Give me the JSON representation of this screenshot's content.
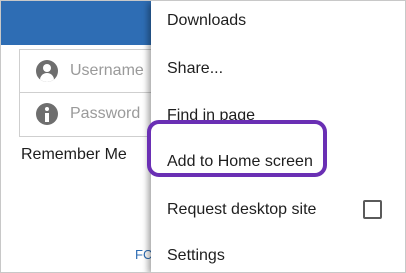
{
  "login": {
    "username_placeholder": "Username",
    "password_placeholder": "Password",
    "remember_label": "Remember Me",
    "bottom_link_partial": "FC"
  },
  "menu": {
    "items": [
      {
        "label": "Downloads"
      },
      {
        "label": "Share..."
      },
      {
        "label": "Find in page"
      },
      {
        "label": "Add to Home screen"
      },
      {
        "label": "Request desktop site",
        "checked": false
      },
      {
        "label": "Settings"
      }
    ]
  },
  "colors": {
    "header_blue": "#2e6db4",
    "highlight_purple": "#6a2fb4"
  }
}
